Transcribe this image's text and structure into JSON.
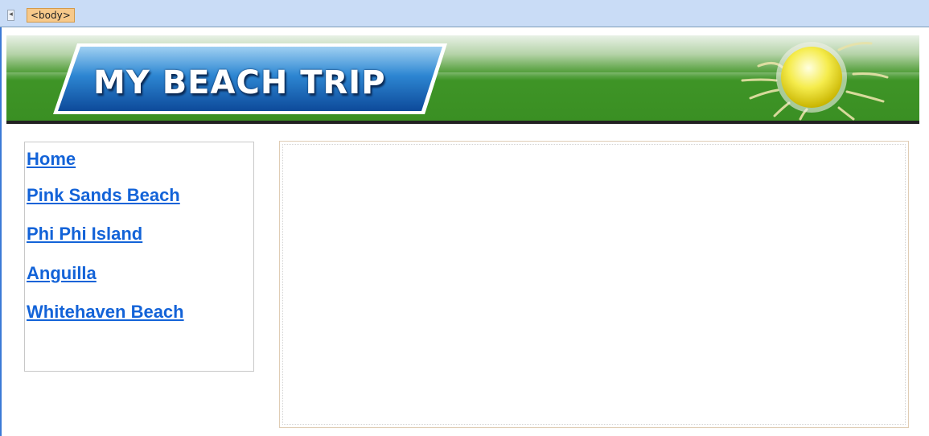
{
  "editor": {
    "tag_label": "<body>",
    "scroll_left_icon": "chevron-left-icon"
  },
  "banner": {
    "logo_text": "MY BEACH TRIP",
    "sun_icon": "sun-icon",
    "colors": {
      "green": "#3a8f23",
      "logo_blue": "#1b63b5",
      "border": "#222222"
    }
  },
  "nav": {
    "items": [
      {
        "label": "Home"
      },
      {
        "label": "Pink Sands Beach"
      },
      {
        "label": "Phi Phi Island"
      },
      {
        "label": "Anguilla"
      },
      {
        "label": "Whitehaven Beach"
      }
    ],
    "link_color": "#1363d8"
  },
  "content": {}
}
